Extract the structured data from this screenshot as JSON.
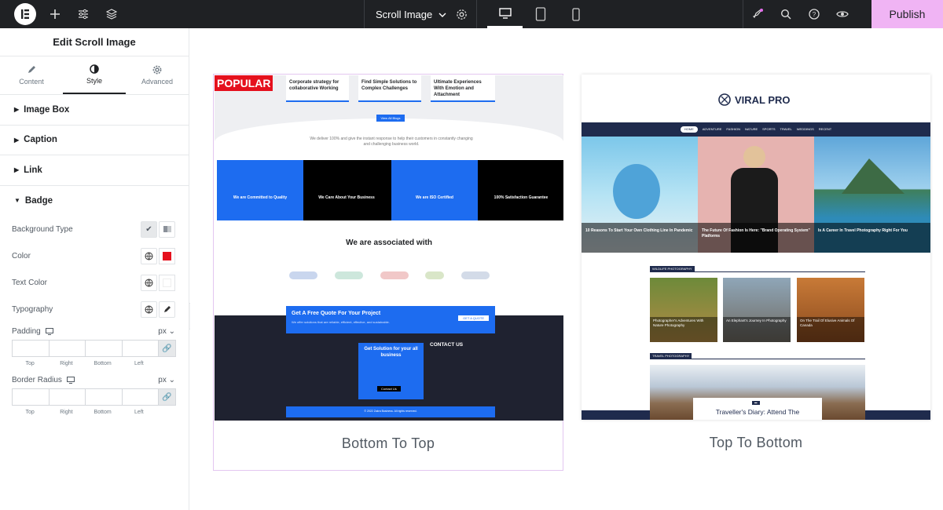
{
  "topbar": {
    "document_title": "Scroll Image",
    "publish_label": "Publish",
    "icons": [
      "elementor-logo-icon",
      "plus-icon",
      "sliders-icon",
      "layers-icon",
      "chevron-down-icon",
      "gear-icon",
      "desktop-icon",
      "tablet-icon",
      "mobile-icon",
      "rocket-icon",
      "search-icon",
      "help-icon",
      "eye-icon"
    ]
  },
  "panel": {
    "title": "Edit Scroll Image",
    "tabs": [
      {
        "label": "Content",
        "icon": "pencil-icon"
      },
      {
        "label": "Style",
        "icon": "contrast-icon"
      },
      {
        "label": "Advanced",
        "icon": "gear-icon"
      }
    ],
    "sections": [
      "Image Box",
      "Caption",
      "Link",
      "Badge"
    ],
    "badge": {
      "background_type_label": "Background Type",
      "color_label": "Color",
      "color_value": "#e5101d",
      "text_color_label": "Text Color",
      "text_color_value": "#ffffff",
      "typography_label": "Typography",
      "padding_label": "Padding",
      "border_radius_label": "Border Radius",
      "unit": "px",
      "dim_labels": [
        "Top",
        "Right",
        "Bottom",
        "Left"
      ]
    }
  },
  "canvas": {
    "card1": {
      "badge": "POPULAR",
      "label": "Bottom To Top",
      "shot": {
        "cards": [
          "Corporate strategy for collaborative Working",
          "Find Simple Solutions to Complex Challenges",
          "Ultimate Experiences With Emotion and Attachment"
        ],
        "button": "View All Blogs",
        "tagline": "We deliver 100% and give the instant response to help their customers in constantly changing and challenging business world.",
        "features": [
          "We are Committed to Quality",
          "We Care About Your Business",
          "We are ISO Certified",
          "100% Satisfaction Guarantee"
        ],
        "associated_title": "We are associated with",
        "quote_title": "Get A Free Quote For Your Project",
        "quote_text": "We offer solutions that are reliable, efficient, effective, and sustainable.",
        "quote_button": "GET A QUOTE",
        "footer_solution": "Get Solution for your all business",
        "footer_button": "Contact Us",
        "contact_title": "CONTACT US",
        "copyright": "© 2022 Zakra Business. All rights reserved."
      }
    },
    "card2": {
      "label": "Top To Bottom",
      "shot": {
        "brand": "VIRAL PRO",
        "nav": [
          "HOME",
          "ADVENTURE",
          "FASHION",
          "NATURE",
          "SPORTS",
          "TRAVEL",
          "WEDDINGS",
          "RECENT"
        ],
        "hero_titles": [
          "10 Reasons To Start Your Own Clothing Line In Pandemic",
          "The Future Of Fashion Is Here: \"Brand Operating System\" Platforms",
          "Is A Career In Travel Photography Right For You"
        ],
        "section1": "WILDLIFE PHOTOGRAPHY",
        "thumbs": [
          "Photographer's Adventures With Nature Photography",
          "An Elephant's Journey In Photography",
          "On The Trail Of Elusive Animals Of Canada"
        ],
        "section2": "TRAVEL PHOTOGRAPHY",
        "feature_title": "Traveller's Diary: Attend The"
      }
    }
  }
}
